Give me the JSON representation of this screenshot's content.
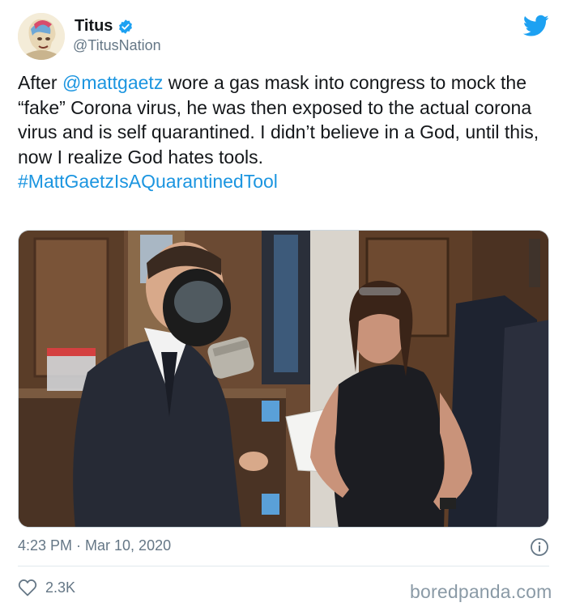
{
  "author": {
    "name": "Titus",
    "handle": "@TitusNation",
    "verified": true
  },
  "tweet": {
    "text_before_mention": "After ",
    "mention": "@mattgaetz",
    "text_after_mention": " wore a gas mask into congress to mock the “fake” Corona virus, he was then exposed to the actual corona virus and is self quarantined. I didn’t believe in a God, until this, now I realize God hates tools.",
    "hashtag": "#MattGaetzIsAQuarantinedTool"
  },
  "footer": {
    "timestamp": "4:23 PM · Mar 10, 2020",
    "like_count": "2.3K"
  },
  "watermark": "boredpanda.com",
  "colors": {
    "link": "#1b95e0",
    "twitter_blue": "#1da1f2",
    "secondary_text": "#657786"
  },
  "icons": {
    "verified": "verified-badge-icon",
    "brand": "twitter-bird-icon",
    "info": "info-icon",
    "like": "heart-icon"
  }
}
